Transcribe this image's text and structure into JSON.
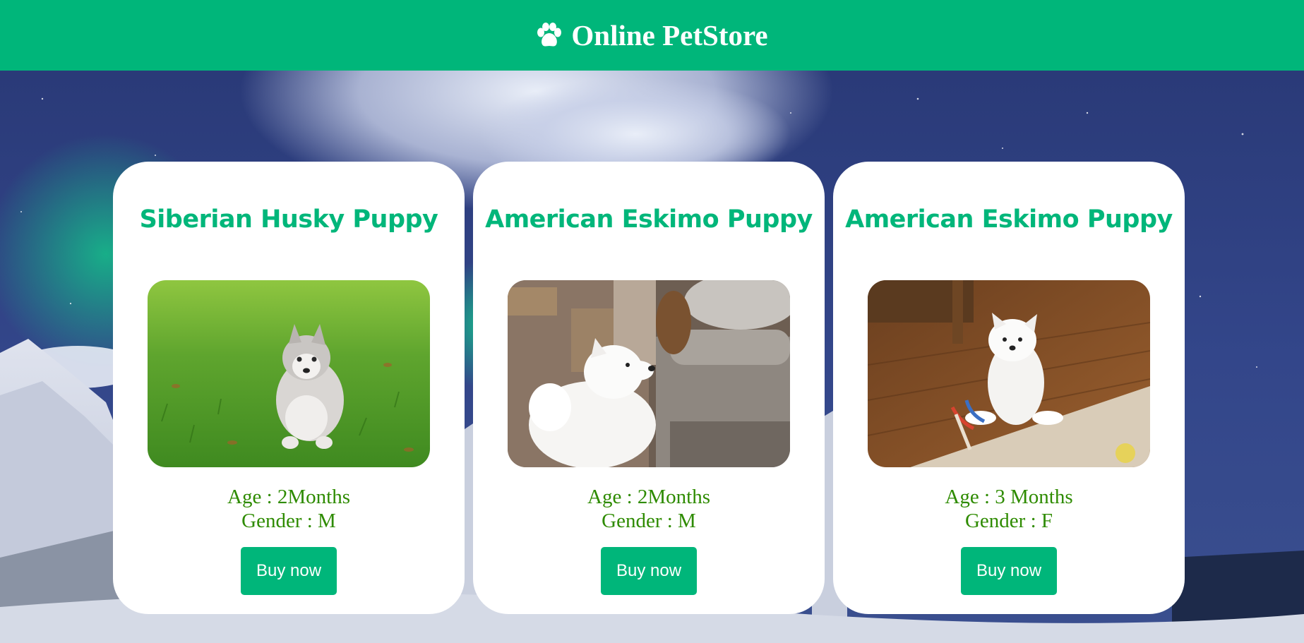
{
  "header": {
    "brand_icon": "paw-icon",
    "title": "Online PetStore",
    "background_color": "#00b67a"
  },
  "cards": [
    {
      "title": "Siberian Husky Puppy",
      "photo": "siberian-husky-puppy-on-grass-photo",
      "age": "Age : 2Months",
      "gender": "Gender : M",
      "button_label": "Buy now"
    },
    {
      "title": "American Eskimo Puppy",
      "photo": "american-eskimo-puppy-by-sofa-photo",
      "age": "Age : 2Months",
      "gender": "Gender : M",
      "button_label": "Buy now"
    },
    {
      "title": "American Eskimo Puppy",
      "photo": "american-eskimo-puppy-on-wood-floor-photo",
      "age": "Age : 3 Months",
      "gender": "Gender : F",
      "button_label": "Buy now"
    }
  ],
  "colors": {
    "accent": "#00b67a",
    "info_text": "#2e8b00",
    "card_background": "#ffffff"
  }
}
